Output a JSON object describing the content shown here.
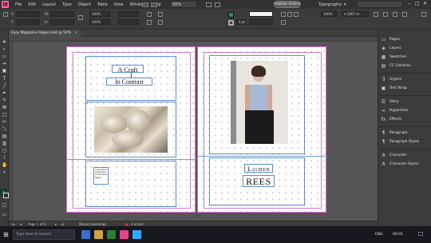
{
  "app": {
    "logo": "Id",
    "title": "Easy Magazine Pages.indd @ 50%"
  },
  "menu": {
    "items": [
      "File",
      "Edit",
      "Layout",
      "Type",
      "Object",
      "Table",
      "View",
      "Window",
      "Help"
    ],
    "zoom": "50%",
    "publish_label": "Publish Online",
    "workspace": "Typography"
  },
  "control": {
    "x_label": "X:",
    "x_value": "",
    "y_label": "Y:",
    "y_value": "",
    "w_label": "W:",
    "h_label": "H:",
    "stroke_weight": "0 pt",
    "percent": "100%",
    "ref_value": "4.2867 m"
  },
  "statusbar": {
    "page": "Page 1 of 2",
    "style": "[Basic] (working)",
    "errors": "2 errors"
  },
  "pages": {
    "left": {
      "title_line1": "A Craft",
      "title_line2": "In Contrast",
      "small_text": "Lorem ipsum\nsample text\nfor the layout\ndesign"
    },
    "right": {
      "name_line1": "Lauren",
      "name_line2": "REES"
    }
  },
  "panels": {
    "items": [
      {
        "icon": "pages-icon",
        "label": "Pages"
      },
      {
        "icon": "layers-icon",
        "label": "Layers"
      },
      {
        "icon": "swatches-icon",
        "label": "Swatches"
      },
      {
        "icon": "cc-libraries-icon",
        "label": "CC Libraries"
      },
      {
        "icon": "glyphs-icon",
        "label": "Glyphs"
      },
      {
        "icon": "text-wrap-icon",
        "label": "Text Wrap"
      },
      {
        "icon": "story-icon",
        "label": "Story"
      },
      {
        "icon": "hyperlinks-icon",
        "label": "Hyperlinks"
      },
      {
        "icon": "effects-icon",
        "label": "Effects"
      },
      {
        "icon": "paragraph-icon",
        "label": "Paragraph"
      },
      {
        "icon": "paragraph-styles-icon",
        "label": "Paragraph Styles"
      },
      {
        "icon": "character-icon",
        "label": "Character"
      },
      {
        "icon": "character-styles-icon",
        "label": "Character Styles"
      }
    ]
  },
  "taskbar": {
    "search": "Type here to search",
    "lang": "ENG",
    "time": "00:01"
  },
  "colors": {
    "accent": "#e0458a",
    "frame": "#5b8fcf",
    "margin": "#cf7fd5",
    "error": "#e04040"
  }
}
